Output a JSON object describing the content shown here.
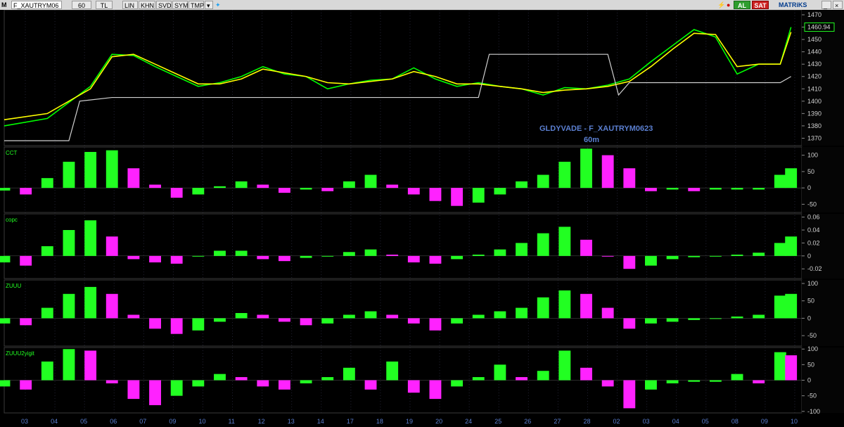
{
  "toolbar": {
    "symbol": "F_XAUTRYM06",
    "period": "60",
    "currency": "TL",
    "buttons": [
      "LIN",
      "KHN",
      "SVD",
      "SYM",
      "TMP"
    ],
    "al_label": "AL",
    "sat_label": "SAT",
    "brand": "MATRiKS",
    "m_label": "M"
  },
  "chart_data": [
    {
      "type": "line",
      "panel": "price",
      "annotation_title": "GLDYVADE - F_XAUTRYM0623",
      "annotation_sub": "60m",
      "price_box": "1460.94",
      "y_ticks": [
        1470,
        1460,
        1450,
        1440,
        1430,
        1420,
        1410,
        1400,
        1390,
        1380,
        1370
      ],
      "ylim": [
        1364,
        1474
      ],
      "series": [
        {
          "color": "#00ff00",
          "x": [
            0,
            2,
            4,
            5,
            6,
            7,
            8,
            9,
            10,
            11,
            12,
            13,
            14,
            15,
            16,
            17,
            18,
            19,
            20,
            21,
            22,
            23,
            24,
            25,
            26,
            27,
            28,
            29,
            30,
            31,
            32,
            33,
            34,
            35,
            36,
            36.5
          ],
          "values": [
            1380,
            1386,
            1412,
            1438,
            1437,
            1428,
            1420,
            1412,
            1415,
            1420,
            1428,
            1422,
            1420,
            1410,
            1414,
            1417,
            1418,
            1427,
            1418,
            1412,
            1415,
            1412,
            1410,
            1405,
            1411,
            1410,
            1413,
            1418,
            1432,
            1445,
            1458,
            1452,
            1422,
            1430,
            1430,
            1460
          ]
        },
        {
          "color": "#ffff00",
          "x": [
            0,
            2,
            4,
            5,
            6,
            7,
            8,
            9,
            10,
            11,
            12,
            13,
            14,
            15,
            16,
            17,
            18,
            19,
            20,
            21,
            22,
            23,
            24,
            25,
            26,
            27,
            28,
            29,
            30,
            31,
            32,
            33,
            34,
            35,
            36,
            36.5
          ],
          "values": [
            1385,
            1390,
            1410,
            1436,
            1438,
            1430,
            1422,
            1414,
            1414,
            1418,
            1426,
            1423,
            1420,
            1415,
            1414,
            1416,
            1418,
            1424,
            1420,
            1414,
            1414,
            1412,
            1410,
            1407,
            1409,
            1410,
            1412,
            1416,
            1428,
            1442,
            1455,
            1454,
            1428,
            1430,
            1430,
            1456
          ]
        },
        {
          "color": "#d0d0d0",
          "x": [
            0,
            3,
            3.5,
            5,
            10,
            22,
            22.5,
            28,
            28.5,
            29,
            31,
            36,
            36.5
          ],
          "values": [
            1368,
            1368,
            1400,
            1403,
            1403,
            1403,
            1438,
            1438,
            1405,
            1415,
            1415,
            1415,
            1420
          ]
        }
      ]
    },
    {
      "type": "bar",
      "panel": "CCT",
      "title": "CCT",
      "y_ticks": [
        100,
        50,
        0,
        -50
      ],
      "ylim": [
        -75,
        125
      ],
      "x": [
        0,
        1,
        2,
        3,
        4,
        5,
        6,
        7,
        8,
        9,
        10,
        11,
        12,
        13,
        14,
        15,
        16,
        17,
        18,
        19,
        20,
        21,
        22,
        23,
        24,
        25,
        26,
        27,
        28,
        29,
        30,
        31,
        32,
        33,
        34,
        35,
        36,
        36.5
      ],
      "values": [
        -8,
        -20,
        30,
        80,
        110,
        115,
        60,
        10,
        -30,
        -20,
        5,
        20,
        10,
        -15,
        -5,
        -10,
        20,
        40,
        10,
        -20,
        -40,
        -55,
        -45,
        -20,
        20,
        40,
        80,
        120,
        100,
        60,
        -10,
        -5,
        -10,
        -5,
        -5,
        -5,
        40,
        60
      ]
    },
    {
      "type": "bar",
      "panel": "copc",
      "title": "copc",
      "y_ticks": [
        0.06,
        0.04,
        0.02,
        0,
        -0.02
      ],
      "ylim": [
        -0.035,
        0.065
      ],
      "x": [
        0,
        1,
        2,
        3,
        4,
        5,
        6,
        7,
        8,
        9,
        10,
        11,
        12,
        13,
        14,
        15,
        16,
        17,
        18,
        19,
        20,
        21,
        22,
        23,
        24,
        25,
        26,
        27,
        28,
        29,
        30,
        31,
        32,
        33,
        34,
        35,
        36,
        36.5
      ],
      "values": [
        -0.01,
        -0.015,
        0.015,
        0.04,
        0.055,
        0.03,
        -0.005,
        -0.01,
        -0.012,
        0,
        0.008,
        0.008,
        -0.005,
        -0.008,
        -0.003,
        0,
        0.006,
        0.01,
        0.002,
        -0.01,
        -0.012,
        -0.005,
        0.002,
        0.01,
        0.02,
        0.035,
        0.045,
        0.025,
        0,
        -0.02,
        -0.015,
        -0.005,
        -0.002,
        0,
        0.002,
        0.005,
        0.02,
        0.03
      ]
    },
    {
      "type": "bar",
      "panel": "ZUUU",
      "title": "ZUUU",
      "y_ticks": [
        100,
        50,
        0,
        -50
      ],
      "ylim": [
        -80,
        110
      ],
      "x": [
        0,
        1,
        2,
        3,
        4,
        5,
        6,
        7,
        8,
        9,
        10,
        11,
        12,
        13,
        14,
        15,
        16,
        17,
        18,
        19,
        20,
        21,
        22,
        23,
        24,
        25,
        26,
        27,
        28,
        29,
        30,
        31,
        32,
        33,
        34,
        35,
        36,
        36.5
      ],
      "values": [
        -15,
        -20,
        30,
        70,
        90,
        70,
        10,
        -30,
        -45,
        -35,
        -10,
        15,
        10,
        -10,
        -20,
        -15,
        10,
        20,
        10,
        -15,
        -35,
        -15,
        10,
        20,
        30,
        60,
        80,
        70,
        30,
        -30,
        -15,
        -10,
        -5,
        0,
        5,
        10,
        65,
        70
      ]
    },
    {
      "type": "bar",
      "panel": "ZUUU2yigit",
      "title": "ZUUU2yigit",
      "y_ticks": [
        100,
        50,
        0,
        -50,
        -100
      ],
      "ylim": [
        -105,
        105
      ],
      "x": [
        0,
        1,
        2,
        3,
        4,
        5,
        6,
        7,
        8,
        9,
        10,
        11,
        12,
        13,
        14,
        15,
        16,
        17,
        18,
        19,
        20,
        21,
        22,
        23,
        24,
        25,
        26,
        27,
        28,
        29,
        30,
        31,
        32,
        33,
        34,
        35,
        36,
        36.5
      ],
      "values": [
        -20,
        -30,
        60,
        100,
        95,
        -10,
        -60,
        -80,
        -50,
        -20,
        20,
        10,
        -20,
        -30,
        -10,
        10,
        40,
        -30,
        60,
        -40,
        -60,
        -20,
        10,
        50,
        10,
        30,
        95,
        40,
        -20,
        -90,
        -30,
        -10,
        -5,
        -5,
        20,
        -10,
        90,
        80
      ]
    }
  ],
  "x_axis": {
    "labels": [
      "03",
      "04",
      "05",
      "06",
      "07",
      "09",
      "10",
      "11",
      "12",
      "13",
      "14",
      "17",
      "18",
      "19",
      "20",
      "24",
      "25",
      "26",
      "27",
      "28",
      "02",
      "03",
      "04",
      "05",
      "08",
      "09",
      "10"
    ]
  }
}
